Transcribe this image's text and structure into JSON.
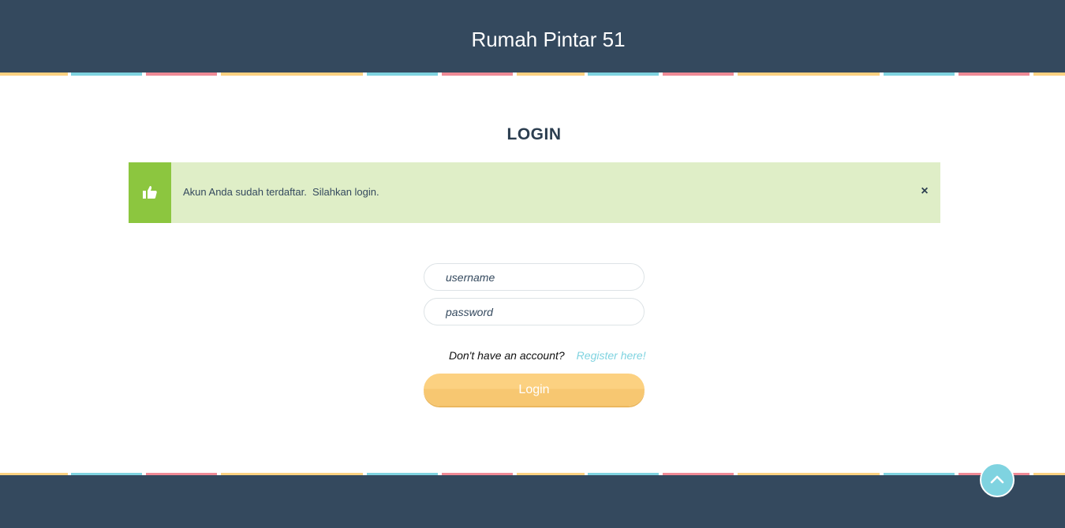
{
  "header": {
    "site_title": "Rumah Pintar 51"
  },
  "main": {
    "heading": "LOGIN",
    "alert": {
      "icon": "thumbs-up-icon",
      "message": "Akun Anda sudah terdaftar.  Silahkan login.",
      "close_label": "×"
    },
    "form": {
      "username_placeholder": "username",
      "password_placeholder": "password",
      "register_prompt": "Don't have an account?",
      "register_link": "Register here!",
      "login_button": "Login"
    }
  },
  "scroll_top": {
    "icon": "chevron-up-icon"
  },
  "colors": {
    "header_bg": "#34495e",
    "alert_bg": "#dfeec7",
    "alert_icon_bg": "#8cc63f",
    "button_bg": "#fcd181",
    "link": "#7fd3e0",
    "stripe_yellow": "#fcd181",
    "stripe_cyan": "#7fd3e0",
    "stripe_pink": "#ef8a96"
  }
}
